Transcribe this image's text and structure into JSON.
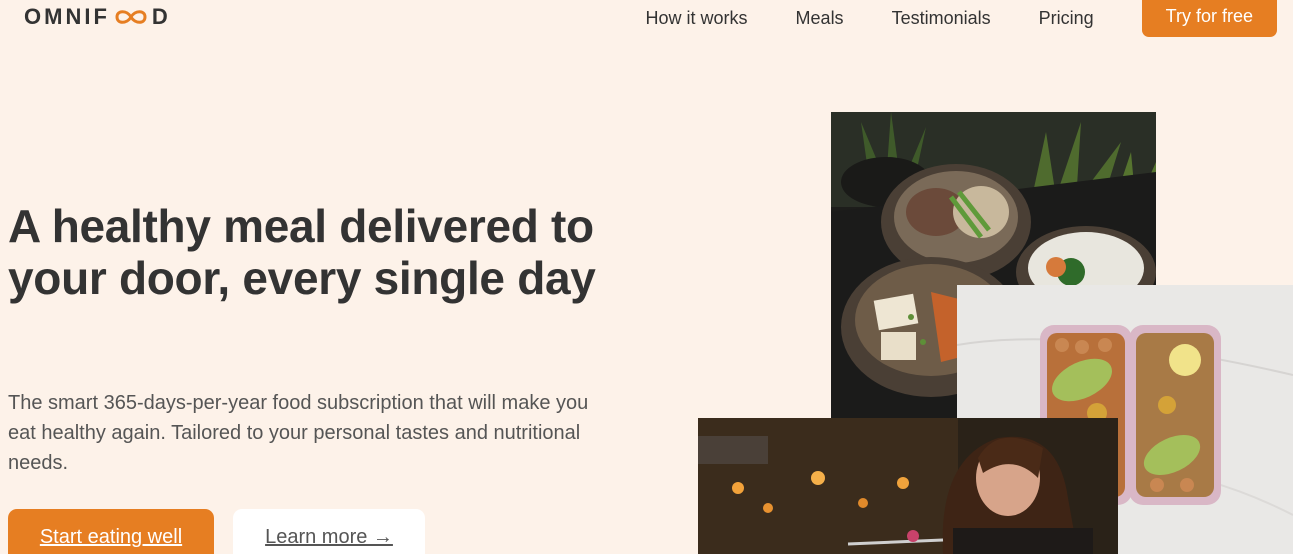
{
  "header": {
    "logo_prefix": "OMNIF",
    "logo_suffix": "D",
    "nav": [
      {
        "label": "How it works"
      },
      {
        "label": "Meals"
      },
      {
        "label": "Testimonials"
      },
      {
        "label": "Pricing"
      }
    ],
    "cta_label": "Try for free"
  },
  "hero": {
    "title": "A healthy meal delivered to your door, every single day",
    "description": "The smart 365-days-per-year food subscription that will make you eat healthy again. Tailored to your personal tastes and nutritional needs.",
    "primary_button": "Start eating well",
    "secondary_button": "Learn more →"
  },
  "colors": {
    "background": "#fdf2e9",
    "accent": "#e67e22",
    "text": "#333333"
  }
}
